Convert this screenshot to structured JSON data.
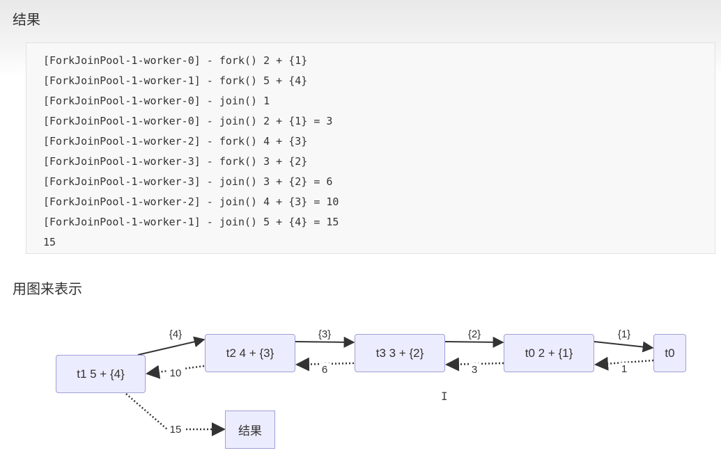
{
  "sections": {
    "result_heading": "结果",
    "diagram_heading": "用图来表示"
  },
  "code_output": {
    "lines": [
      "[ForkJoinPool-1-worker-0] - fork() 2 + {1}",
      "[ForkJoinPool-1-worker-1] - fork() 5 + {4}",
      "[ForkJoinPool-1-worker-0] - join() 1",
      "[ForkJoinPool-1-worker-0] - join() 2 + {1} = 3",
      "[ForkJoinPool-1-worker-2] - fork() 4 + {3}",
      "[ForkJoinPool-1-worker-3] - fork() 3 + {2}",
      "[ForkJoinPool-1-worker-3] - join() 3 + {2} = 6",
      "[ForkJoinPool-1-worker-2] - join() 4 + {3} = 10",
      "[ForkJoinPool-1-worker-1] - join() 5 + {4} = 15",
      "15"
    ]
  },
  "diagram": {
    "nodes": {
      "t1": "t1 5 + {4}",
      "t2": "t2 4 + {3}",
      "t3": "t3 3 + {2}",
      "t0_task": "t0 2 + {1}",
      "t0": "t0",
      "result": "结果"
    },
    "edges": {
      "t1_to_t2": "{4}",
      "t2_to_t3": "{3}",
      "t3_to_t0task": "{2}",
      "t0task_to_t0": "{1}",
      "t0_to_t0task": "1",
      "t0task_to_t3": "3",
      "t3_to_t2": "6",
      "t2_to_t1": "10",
      "t1_to_result": "15"
    }
  },
  "colors": {
    "node_fill": "#ececff",
    "node_border": "#9f9fd6",
    "edge_stroke": "#333333"
  }
}
